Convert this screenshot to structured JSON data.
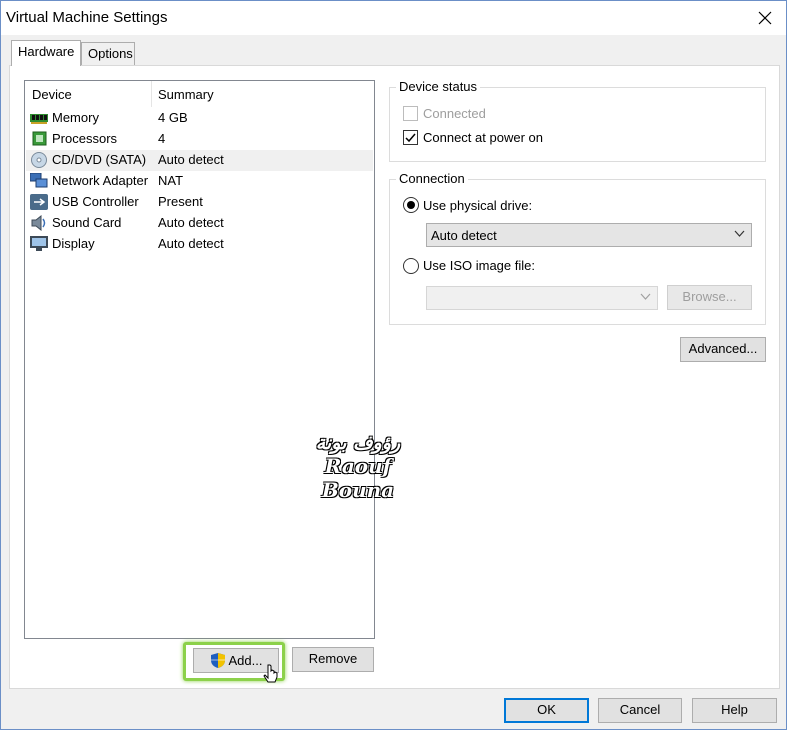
{
  "window": {
    "title": "Virtual Machine Settings"
  },
  "tabs": [
    {
      "label": "Hardware",
      "active": true
    },
    {
      "label": "Options",
      "active": false
    }
  ],
  "device_list": {
    "columns": [
      "Device",
      "Summary"
    ],
    "rows": [
      {
        "icon": "memory-icon",
        "name": "Memory",
        "summary": "4 GB"
      },
      {
        "icon": "processor-icon",
        "name": "Processors",
        "summary": "4"
      },
      {
        "icon": "cd-dvd-icon",
        "name": "CD/DVD (SATA)",
        "summary": "Auto detect",
        "selected": true
      },
      {
        "icon": "network-adapter-icon",
        "name": "Network Adapter",
        "summary": "NAT"
      },
      {
        "icon": "usb-icon",
        "name": "USB Controller",
        "summary": "Present"
      },
      {
        "icon": "sound-card-icon",
        "name": "Sound Card",
        "summary": "Auto detect"
      },
      {
        "icon": "display-icon",
        "name": "Display",
        "summary": "Auto detect"
      }
    ],
    "add_label": "Add...",
    "remove_label": "Remove"
  },
  "device_status": {
    "title": "Device status",
    "connected_label": "Connected",
    "connected_checked": false,
    "connected_enabled": false,
    "connect_power_label": "Connect at power on",
    "connect_power_checked": true
  },
  "connection": {
    "title": "Connection",
    "physical_label": "Use physical drive:",
    "physical_selected": true,
    "physical_value": "Auto detect",
    "iso_label": "Use ISO image file:",
    "iso_selected": false,
    "iso_value": "",
    "browse_label": "Browse..."
  },
  "advanced_label": "Advanced...",
  "watermark": {
    "arabic": "رؤوف بونة",
    "latin": "Raouf Bouna"
  },
  "footer": {
    "ok": "OK",
    "cancel": "Cancel",
    "help": "Help"
  },
  "colors": {
    "accent": "#0078d7",
    "highlight": "#8cd14a",
    "selected_row": "#f0f0f0"
  }
}
